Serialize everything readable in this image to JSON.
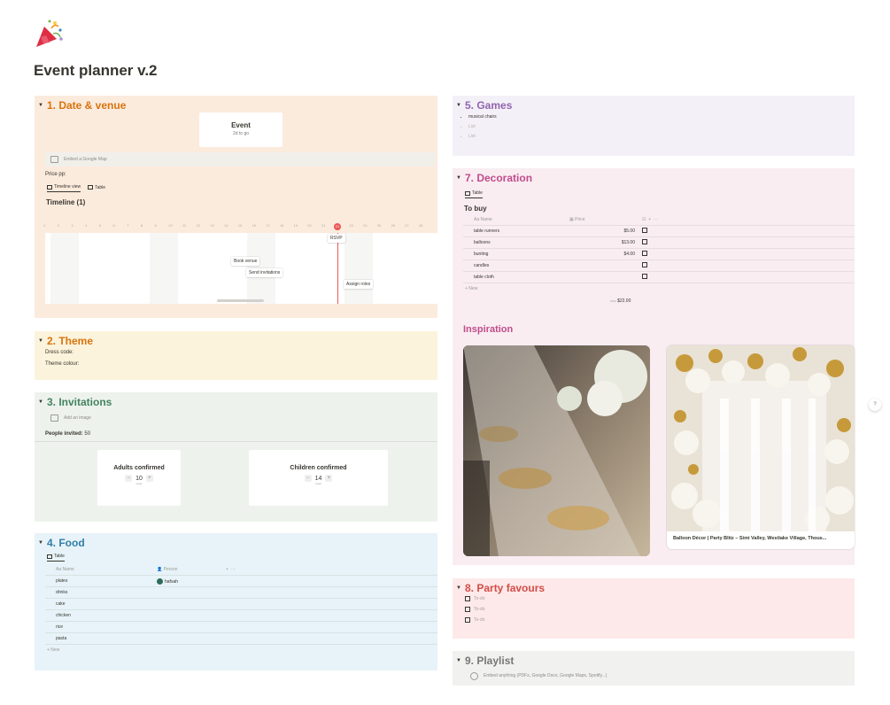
{
  "page": {
    "icon": "party-popper-icon",
    "title": "Event planner v.2"
  },
  "s1": {
    "title": "1. Date & venue",
    "card_title": "Event",
    "card_sub": "2d to go",
    "embed_label": "Embed a Google Map",
    "price_label": "Price pp:",
    "tab_timeline": "Timeline view",
    "tab_table": "Table",
    "timeline_title": "Timeline (1)",
    "days": [
      "1",
      "2",
      "3",
      "4",
      "5",
      "6",
      "7",
      "8",
      "9",
      "10",
      "11",
      "12",
      "13",
      "14",
      "15",
      "16",
      "17",
      "18",
      "19",
      "20",
      "21",
      "22",
      "23",
      "24",
      "25",
      "26",
      "27",
      "28"
    ],
    "today": "21",
    "items": {
      "rsvp": "RSVP",
      "book": "Book venue",
      "send": "Send invitations",
      "assign": "Assign roles"
    }
  },
  "s2": {
    "title": "2. Theme",
    "dress": "Dress code:",
    "colour": "Theme colour:"
  },
  "s3": {
    "title": "3. Invitations",
    "add_image": "Add an image",
    "people_label": "People invited:",
    "people_value": "50",
    "adults_title": "Adults confirmed",
    "adults_value": "10",
    "children_title": "Children confirmed",
    "children_value": "14",
    "reset": "reset"
  },
  "s4": {
    "title": "4. Food",
    "tab_table": "Table",
    "col_name": "Aa Name",
    "col_person": "Person",
    "person": "hafsah",
    "rows": [
      "plates",
      "drinks",
      "cake",
      "chicken",
      "rice",
      "pasta"
    ],
    "new": "+ New"
  },
  "s5": {
    "title": "5. Games",
    "items": [
      "musical chairs",
      "List",
      "List"
    ]
  },
  "s7": {
    "title": "7. Decoration",
    "tab_table": "Table",
    "table_title": "To buy",
    "col_name": "Aa Name",
    "col_price": "Price",
    "rows": [
      {
        "name": "table runners",
        "price": "$5.00"
      },
      {
        "name": "balloons",
        "price": "$13.00"
      },
      {
        "name": "bunting",
        "price": "$4.00"
      },
      {
        "name": "candles",
        "price": ""
      },
      {
        "name": "table cloth",
        "price": ""
      }
    ],
    "new": "+ New",
    "sum_label": "SUM",
    "sum_value": "$22.00",
    "inspiration": "Inspiration",
    "caption": "Balloon Décor | Party Blitz – Simi Valley, Westlake Village, Thous..."
  },
  "s8": {
    "title": "8. Party favours",
    "todos": [
      "To-do",
      "To-do",
      "To-do"
    ]
  },
  "s9": {
    "title": "9. Playlist",
    "embed": "Embed anything (PDFs, Google Docs, Google Maps, Spotify...)"
  },
  "help": "?"
}
